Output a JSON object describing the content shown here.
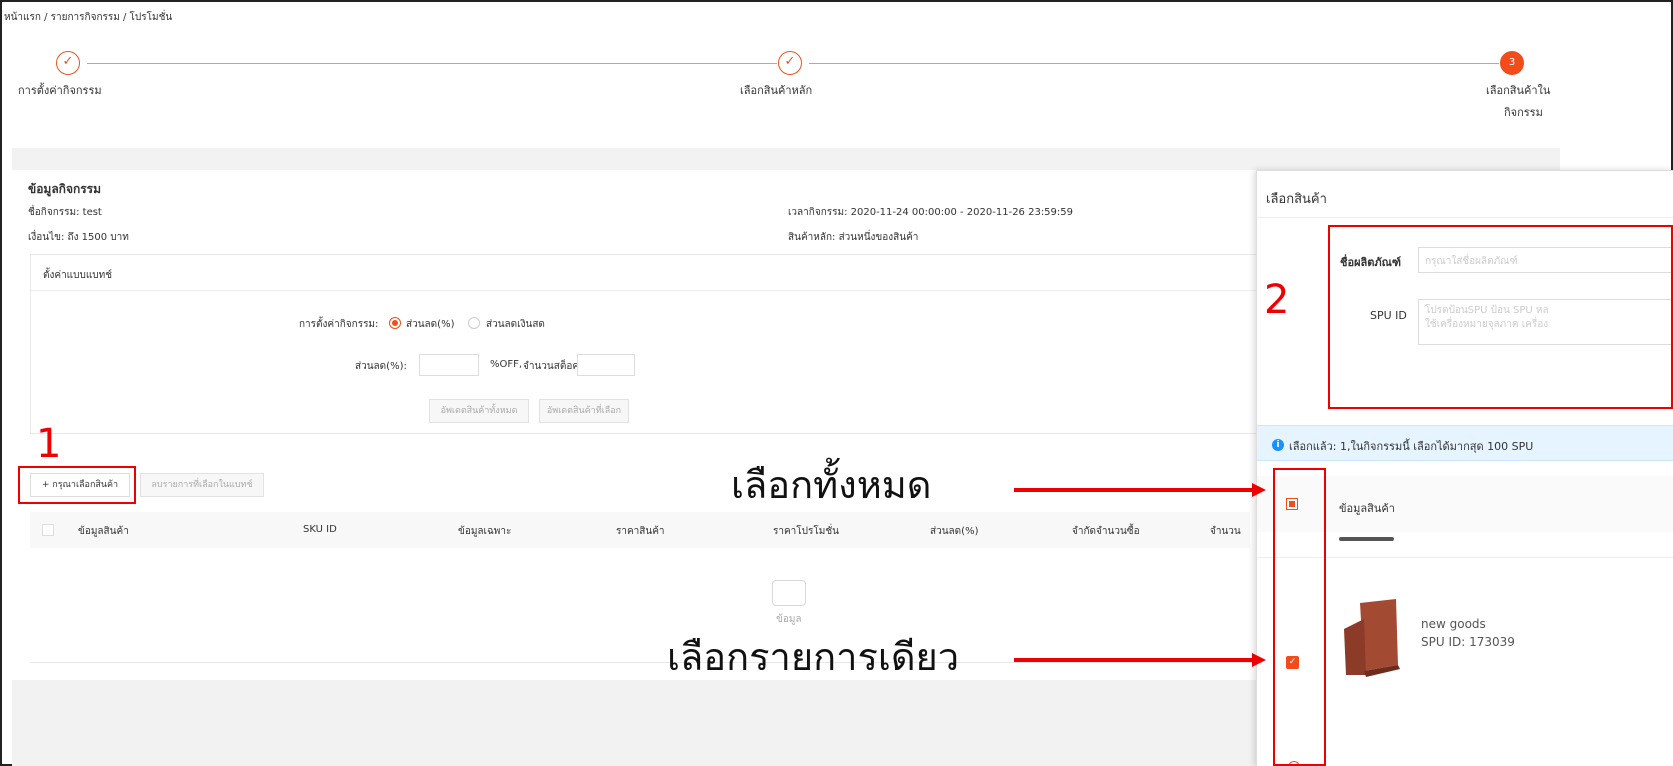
{
  "breadcrumb": "หน้าแรก / รายการกิจกรรม / โปรโมชั่น",
  "steps": [
    {
      "label": "การตั้งค่ากิจกรรม",
      "icon": "check-icon",
      "mark": "✓"
    },
    {
      "label": "เลือกสินค้าหลัก",
      "icon": "check-icon",
      "mark": "✓"
    },
    {
      "label_line1": "เลือกสินค้าใน",
      "label_line2": "กิจกรรม",
      "number": "3"
    }
  ],
  "activity": {
    "title": "ข้อมูลกิจกรรม",
    "name": "ชื่อกิจกรรม: test",
    "condition": "เงื่อนไข: ถึง 1500 บาท",
    "time": "เวลากิจกรรม: 2020-11-24 00:00:00 - 2020-11-26 23:59:59",
    "main_product": "สินค้าหลัก: ส่วนหนึ่งของสินค้า"
  },
  "batch": {
    "title": "ตั้งค่าแบบแบทช์",
    "setting_label": "การตั้งค่ากิจกรรม:",
    "option_percent": "ส่วนลด(%)",
    "option_cash": "ส่วนลดเงินสด",
    "discount_label": "ส่วนลด(%):",
    "off_label": "%OFF,",
    "stock_label": "จำนวนสต็อค",
    "update_all": "อัพเดตสินค้าทั้งหมด",
    "update_selected": "อัพเดตสินค้าที่เลือก"
  },
  "toolbar": {
    "add_product": "+ กรุณาเลือกสินค้า",
    "delete_selected": "ลบรายการที่เลือกในแบทช์"
  },
  "table": {
    "headers": [
      "ข้อมูลสินค้า",
      "SKU ID",
      "ข้อมูลเฉพาะ",
      "ราคาสินค้า",
      "ราคาโปรโมชั่น",
      "ส่วนลด(%)",
      "จำกัดจำนวนซื้อ",
      "จำนวน"
    ],
    "empty_text": "ข้อมูล"
  },
  "annotations": {
    "n1": "1",
    "n2": "2",
    "select_all": "เลือกทั้งหมด",
    "select_one": "เลือกรายการเดียว",
    "color": "#e00000"
  },
  "panel": {
    "title": "เลือกสินค้า",
    "name_label": "ชื่อผลิตภัณฑ์",
    "name_placeholder": "กรุณาใส่ชื่อผลิตภัณฑ์",
    "spu_label": "SPU ID",
    "spu_placeholder_line1": "โปรดป้อนSPU ป้อน SPU หล",
    "spu_placeholder_line2": "ใช้เครื่องหมายจุลภาค เครื่อง",
    "info": "เลือกแล้ว: 1,ในกิจกรรมนี้ เลือกได้มากสุด 100 SPU",
    "col_header": "ข้อมูลสินค้า",
    "item": {
      "name": "new goods",
      "spu": "SPU ID: 173039"
    }
  },
  "colors": {
    "accent": "#f04d1a",
    "info": "#1890ff",
    "product": "#a34a33"
  }
}
